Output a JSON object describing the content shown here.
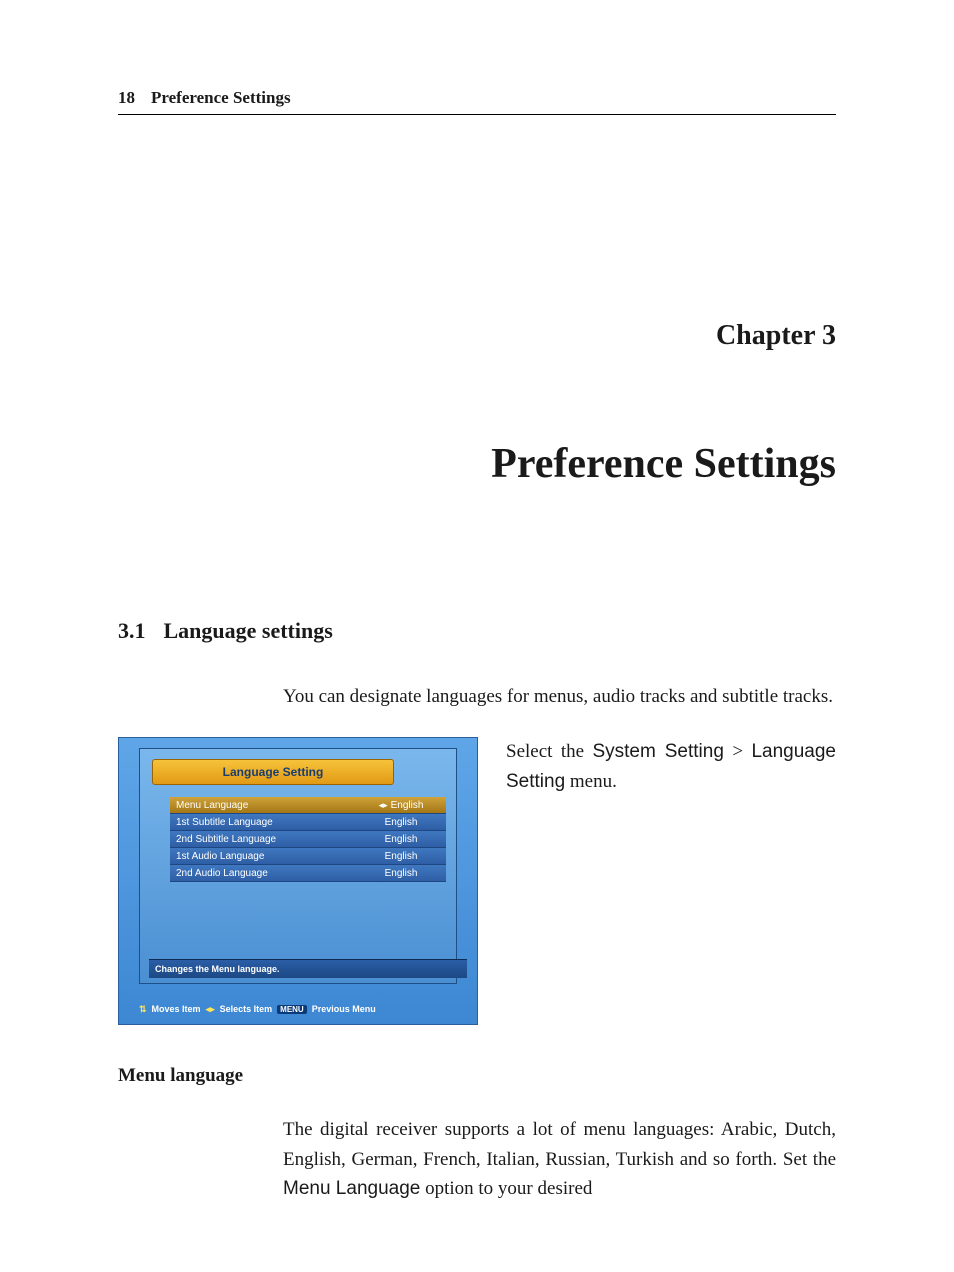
{
  "header": {
    "page_number": "18",
    "running_title": "Preference Settings"
  },
  "chapter": {
    "label": "Chapter 3",
    "title": "Preference Settings"
  },
  "section": {
    "number": "3.1",
    "title": "Language settings",
    "intro": "You can designate languages for menus, audio tracks and subtitle tracks."
  },
  "figure_side_text": {
    "lead": "Select the ",
    "path1": "System Setting",
    "sep": " > ",
    "path2": "Language Setting",
    "tail": " menu."
  },
  "osd": {
    "title": "Language Setting",
    "rows": [
      {
        "label": "Menu Language",
        "value": "English",
        "selected": true
      },
      {
        "label": "1st Subtitle Language",
        "value": "English",
        "selected": false
      },
      {
        "label": "2nd Subtitle Language",
        "value": "English",
        "selected": false
      },
      {
        "label": "1st Audio Language",
        "value": "English",
        "selected": false
      },
      {
        "label": "2nd Audio Language",
        "value": "English",
        "selected": false
      }
    ],
    "status": "Changes the Menu language.",
    "hints": {
      "moves": "Moves Item",
      "selects": "Selects Item",
      "menu_tag": "MENU",
      "prev": "Previous Menu"
    }
  },
  "subsection": {
    "heading": "Menu language",
    "para_a": "The digital receiver supports a lot of menu languages: Arabic, Dutch, English, German, French, Italian, Russian, Turkish and so forth.  Set the ",
    "para_opt": "Menu Language",
    "para_b": " option to your desired"
  }
}
